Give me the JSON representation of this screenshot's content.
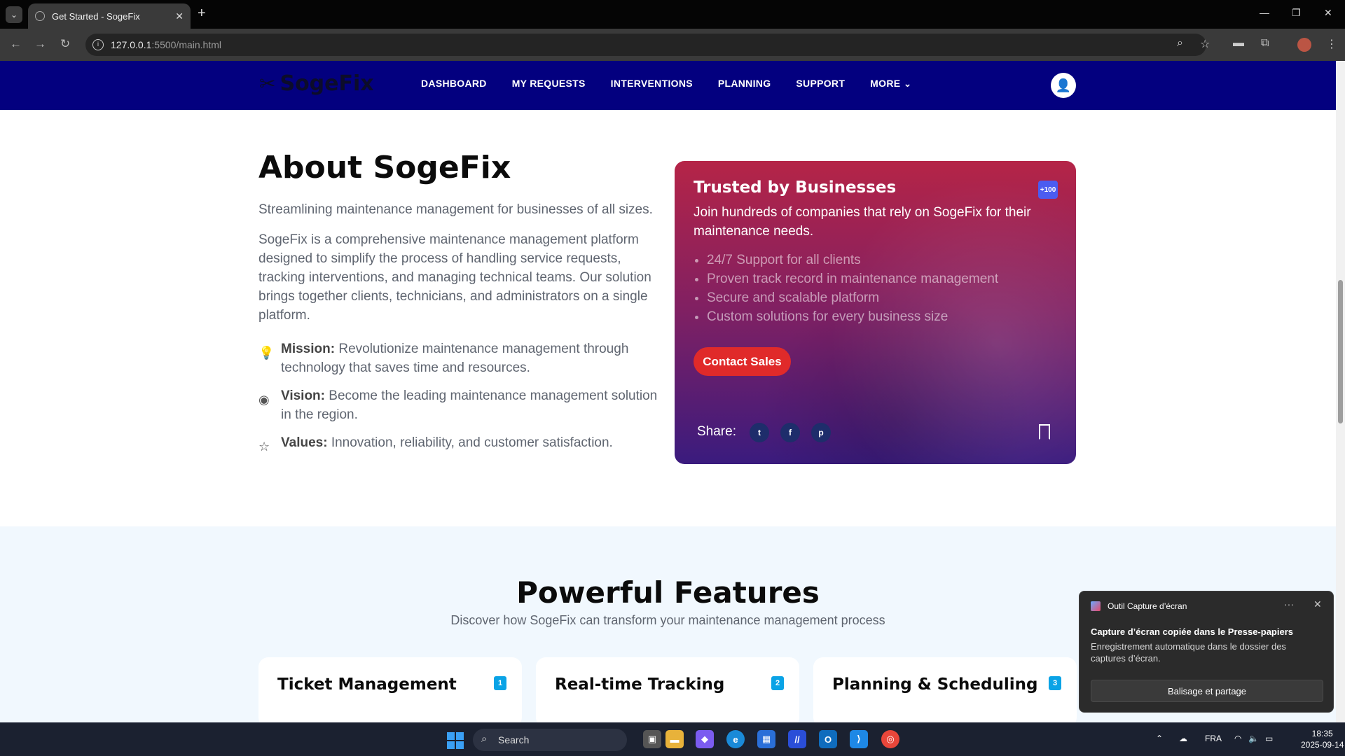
{
  "browser": {
    "tab_title": "Get Started - SogeFix",
    "url_host": "127.0.0.1",
    "url_rest": ":5500/main.html"
  },
  "site": {
    "logo": "SogeFix",
    "nav": [
      "DASHBOARD",
      "MY REQUESTS",
      "INTERVENTIONS",
      "PLANNING",
      "SUPPORT",
      "MORE"
    ]
  },
  "about": {
    "title": "About SogeFix",
    "subtitle": "Streamlining maintenance management for businesses of all sizes.",
    "body": "SogeFix is a comprehensive maintenance management platform designed to simplify the process of handling service requests, tracking interventions, and managing technical teams. Our solution brings together clients, technicians, and administrators on a single platform.",
    "mission_label": "Mission:",
    "mission_text": " Revolutionize maintenance management through technology that saves time and resources.",
    "vision_label": "Vision:",
    "vision_text": " Become the leading maintenance management solution in the region.",
    "values_label": "Values:",
    "values_text": " Innovation, reliability, and customer satisfaction."
  },
  "trust_card": {
    "title": "Trusted by Businesses",
    "badge": "+100",
    "lead": "Join hundreds of companies that rely on SogeFix for their maintenance needs.",
    "points": [
      "24/7 Support for all clients",
      "Proven track record in maintenance management",
      "Secure and scalable platform",
      "Custom solutions for every business size"
    ],
    "cta": "Contact Sales",
    "share_label": "Share:"
  },
  "features": {
    "title": "Powerful Features",
    "subtitle": "Discover how SogeFix can transform your maintenance management process",
    "cards": [
      {
        "title": "Ticket Management",
        "num": "1"
      },
      {
        "title": "Real-time Tracking",
        "num": "2"
      },
      {
        "title": "Planning & Scheduling",
        "num": "3"
      }
    ]
  },
  "toast": {
    "app": "Outil Capture d’écran",
    "title": "Capture d’écran copiée dans le Presse-papiers",
    "body": "Enregistrement automatique dans le dossier des captures d’écran.",
    "action": "Balisage et partage"
  },
  "taskbar": {
    "search": "Search",
    "lang": "FRA",
    "time": "18:35",
    "date": "2025-09-14"
  },
  "colors": {
    "header_bg": "#03007f",
    "cta": "#e02a2a",
    "feature_num": "#0aa3e6",
    "features_bg": "#f1f8fe"
  }
}
